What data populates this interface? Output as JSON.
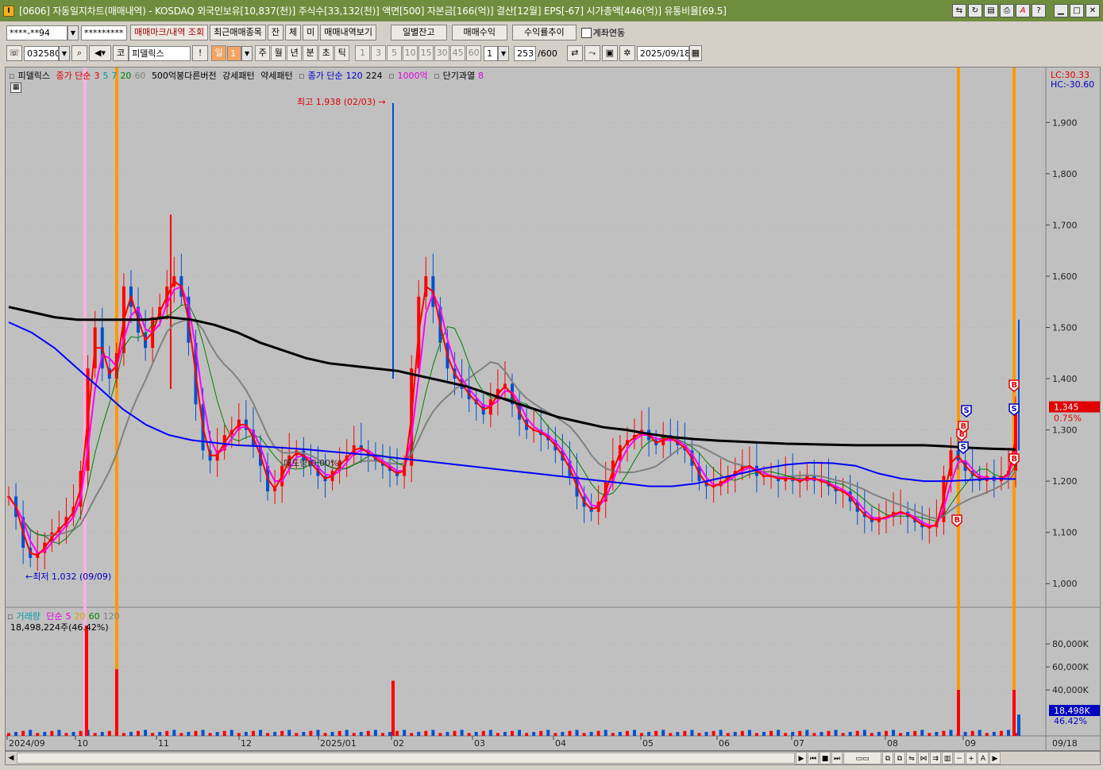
{
  "window": {
    "title": "[0606] 자동일지차트(매매내역) - KOSDAQ 외국인보유[10,837(천)] 주식수[33,132(천)] 액면[500] 자본금[166(억)] 결산[12월] EPS[-67] 시가총액[446(억)] 유통비율[69.5]",
    "icon": "I"
  },
  "toolbar1": {
    "account": "****-**94",
    "password": "*********",
    "trade_mark_button": "매매마크/내역 조회",
    "recent_items_button": "최근매매종목",
    "balance_button": "잔",
    "filled_button": "체",
    "unfilled_button": "미",
    "trade_detail_button": "매매내역보기",
    "daily_balance_button": "일별잔고",
    "trade_profit_button": "매매수익",
    "return_trend_button": "수익률추이",
    "account_link_label": "계좌연동"
  },
  "toolbar2": {
    "code": "032580",
    "market_prefix": "코",
    "stock_name": "피델릭스",
    "alert_button": "!",
    "period_label": "일",
    "period_value": "1",
    "period_buttons": [
      "주",
      "월",
      "년",
      "분",
      "초",
      "틱"
    ],
    "interval_buttons": [
      "1",
      "3",
      "5",
      "10",
      "15",
      "30",
      "45",
      "60"
    ],
    "interval_value": "1",
    "count_current": "253",
    "count_total": "/600",
    "date": "2025/09/18"
  },
  "price_legend": {
    "name": "피델릭스",
    "ma_label": "종가 단순",
    "ma_periods": [
      "3",
      "5",
      "7",
      "20",
      "60"
    ],
    "pattern_1": "500억봉다른버전",
    "pattern_2": "강세패턴",
    "pattern_3": "약세패턴",
    "ma_long_label": "종가 단순",
    "ma_long_periods": [
      "120",
      "224"
    ],
    "amount_label": "1000억",
    "short_over_label": "단기과열",
    "short_over_value": "8"
  },
  "volume_legend": {
    "name": "거래량",
    "ma_label": "단순",
    "ma_periods": [
      "5",
      "20",
      "60",
      "120"
    ],
    "current": "18,498,224주(46.42%)"
  },
  "annotations": {
    "high": "최고 1,938 (02/03) →",
    "low": "←최저 1,032 (09/09)",
    "overlap": "매도량(0.00%)",
    "lc": "LC:30.33",
    "hc": "HC:-30.60",
    "current_price": "1,345",
    "current_change": "0.75%",
    "current_volume": "18,498K",
    "current_volume_ratio": "46.42%"
  },
  "colors": {
    "titlebar": "#6f8e3d",
    "chart_bg": "#c0c0c0",
    "up_candle": "#ff0000",
    "down_candle": "#0050d0",
    "ma3": "#ff0000",
    "ma5": "#00b0a0",
    "ma7": "#ff00ff",
    "ma20": "#008000",
    "ma60": "#808080",
    "ma120": "#0000ff",
    "ma224": "#000000",
    "marker_line_orange": "#ff9900",
    "marker_line_pink": "#ffb0e0"
  },
  "chart_data": {
    "type": "candlestick",
    "price_axis": {
      "ticks": [
        "1,900",
        "1,800",
        "1,700",
        "1,600",
        "1,500",
        "1,400",
        "1,300",
        "1,200",
        "1,100",
        "1,000"
      ],
      "values": [
        1900,
        1800,
        1700,
        1600,
        1500,
        1400,
        1300,
        1200,
        1100,
        1000
      ],
      "range": [
        960,
        1995
      ]
    },
    "volume_axis": {
      "ticks": [
        "80,000K",
        "60,000K",
        "40,000K"
      ],
      "values": [
        80000,
        60000,
        40000
      ],
      "range": [
        0,
        105000
      ]
    },
    "x_axis": {
      "labels": [
        "2024/09",
        "10",
        "11",
        "12",
        "2025/01",
        "02",
        "03",
        "04",
        "05",
        "06",
        "07",
        "08",
        "09"
      ],
      "last_date_label": "09/18"
    },
    "price_series": {
      "name": "피델릭스",
      "close": [
        1170,
        1130,
        1070,
        1050,
        1060,
        1080,
        1100,
        1110,
        1130,
        1150,
        1220,
        1420,
        1500,
        1420,
        1400,
        1450,
        1580,
        1540,
        1490,
        1460,
        1520,
        1540,
        1580,
        1600,
        1560,
        1470,
        1350,
        1260,
        1240,
        1260,
        1290,
        1300,
        1320,
        1300,
        1270,
        1230,
        1180,
        1190,
        1230,
        1250,
        1260,
        1240,
        1230,
        1210,
        1200,
        1220,
        1240,
        1250,
        1270,
        1260,
        1250,
        1240,
        1230,
        1220,
        1210,
        1230,
        1420,
        1560,
        1600,
        1540,
        1470,
        1420,
        1400,
        1380,
        1360,
        1350,
        1330,
        1360,
        1380,
        1390,
        1350,
        1320,
        1300,
        1300,
        1290,
        1280,
        1260,
        1240,
        1210,
        1170,
        1150,
        1140,
        1160,
        1200,
        1240,
        1270,
        1280,
        1290,
        1300,
        1280,
        1270,
        1290,
        1280,
        1270,
        1260,
        1230,
        1200,
        1190,
        1190,
        1200,
        1210,
        1220,
        1230,
        1230,
        1210,
        1210,
        1210,
        1200,
        1210,
        1200,
        1200,
        1210,
        1200,
        1200,
        1190,
        1180,
        1180,
        1160,
        1140,
        1130,
        1120,
        1130,
        1130,
        1140,
        1140,
        1130,
        1120,
        1110,
        1110,
        1120,
        1210,
        1260,
        1240,
        1220,
        1210,
        1200,
        1210,
        1200,
        1210,
        1220,
        1345
      ],
      "ma120": [
        1510,
        1490,
        1460,
        1420,
        1380,
        1340,
        1310,
        1290,
        1280,
        1275,
        1270,
        1268,
        1265,
        1262,
        1258,
        1254,
        1250,
        1245,
        1240,
        1235,
        1230,
        1225,
        1220,
        1215,
        1210,
        1205,
        1200,
        1195,
        1190,
        1190,
        1195,
        1205,
        1215,
        1225,
        1232,
        1236,
        1235,
        1230,
        1215,
        1205,
        1200,
        1200,
        1202,
        1205,
        1204
      ],
      "ma224": [
        1540,
        1530,
        1520,
        1515,
        1515,
        1515,
        1515,
        1520,
        1515,
        1505,
        1490,
        1470,
        1455,
        1440,
        1430,
        1425,
        1420,
        1415,
        1405,
        1395,
        1385,
        1370,
        1355,
        1340,
        1325,
        1315,
        1305,
        1300,
        1292,
        1286,
        1282,
        1279,
        1277,
        1275,
        1273,
        1272,
        1271,
        1270,
        1270,
        1270,
        1270,
        1268,
        1265,
        1263,
        1262
      ]
    },
    "volume_series": {
      "name": "거래량",
      "spikes": [
        {
          "x_label": "10",
          "value": 96000
        },
        {
          "x_label": "10",
          "value": 58000
        },
        {
          "x_label": "02",
          "value": 48000
        },
        {
          "x_label": "09",
          "value": 40000
        },
        {
          "x_label": "09",
          "value": 40000
        },
        {
          "x_label": "09/18",
          "value": 18498
        }
      ]
    },
    "signals": [
      "S",
      "S",
      "S",
      "B",
      "B",
      "B",
      "B",
      "B"
    ]
  }
}
